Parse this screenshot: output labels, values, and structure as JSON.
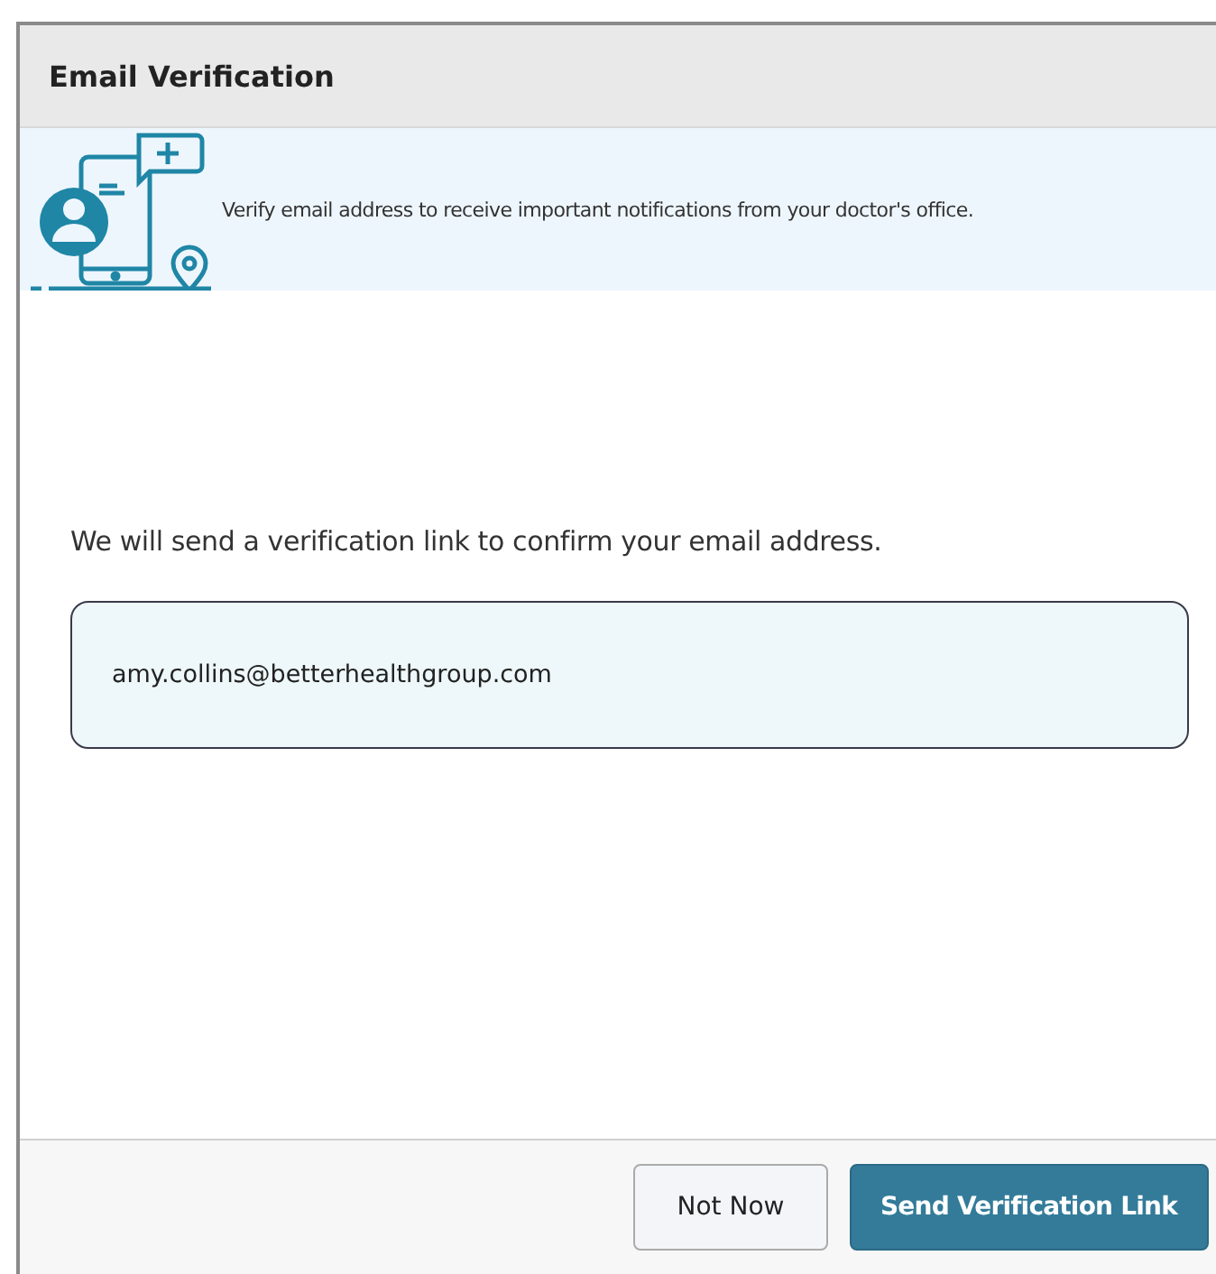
{
  "dialog": {
    "title": "Email Verification"
  },
  "banner": {
    "message": "Verify email address to receive important notifications from your doctor's office."
  },
  "body": {
    "instruction": "We will send a verification link to confirm your email address.",
    "email_field": {
      "value": "amy.collins@betterhealthgroup.com"
    }
  },
  "buttons": [
    {
      "label": "Not Now",
      "kind": "secondary"
    },
    {
      "label": "Send Verification Link",
      "kind": "primary"
    }
  ]
}
